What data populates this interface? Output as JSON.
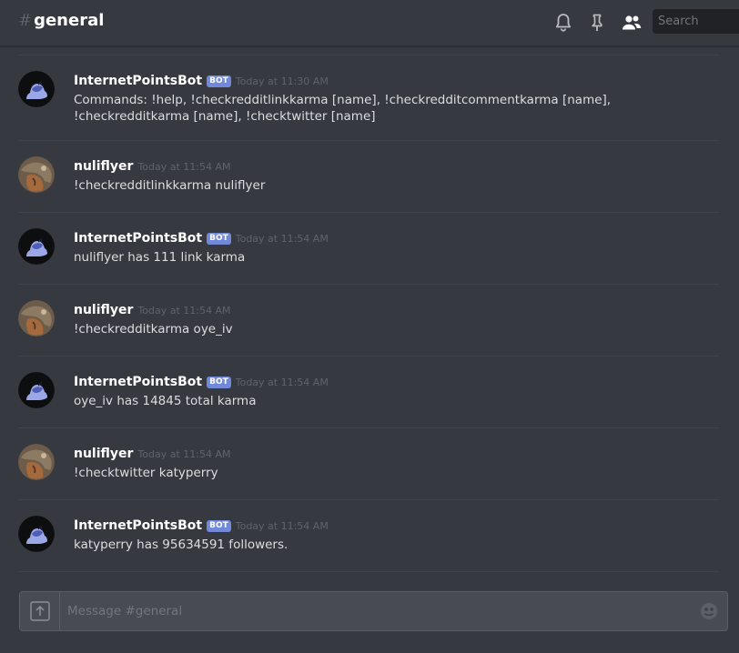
{
  "header": {
    "hash": "#",
    "channel": "general",
    "search_placeholder": "Search",
    "icons": [
      "bell-icon",
      "pin-icon",
      "members-icon"
    ]
  },
  "messages": [
    {
      "author": "InternetPointsBot",
      "bot": true,
      "badge": "BOT",
      "timestamp": "Today at 11:30 AM",
      "text": "Commands: !help, !checkredditlinkkarma [name], !checkredditcommentkarma [name], !checkredditkarma [name], !checktwitter [name]",
      "avatar": "bot-avatar"
    },
    {
      "author": "nuliflyer",
      "bot": false,
      "timestamp": "Today at 11:54 AM",
      "text": "!checkredditlinkkarma nuliflyer",
      "avatar": "user-avatar"
    },
    {
      "author": "InternetPointsBot",
      "bot": true,
      "badge": "BOT",
      "timestamp": "Today at 11:54 AM",
      "text": "nuliflyer has 111 link karma",
      "avatar": "bot-avatar"
    },
    {
      "author": "nuliflyer",
      "bot": false,
      "timestamp": "Today at 11:54 AM",
      "text": "!checkredditkarma oye_iv",
      "avatar": "user-avatar"
    },
    {
      "author": "InternetPointsBot",
      "bot": true,
      "badge": "BOT",
      "timestamp": "Today at 11:54 AM",
      "text": "oye_iv has 14845 total karma",
      "avatar": "bot-avatar"
    },
    {
      "author": "nuliflyer",
      "bot": false,
      "timestamp": "Today at 11:54 AM",
      "text": "!checktwitter katyperry",
      "avatar": "user-avatar"
    },
    {
      "author": "InternetPointsBot",
      "bot": true,
      "badge": "BOT",
      "timestamp": "Today at 11:54 AM",
      "text": "katyperry has 95634591 followers.",
      "avatar": "bot-avatar"
    }
  ],
  "composer": {
    "placeholder": "Message #general",
    "icons": [
      "upload-icon",
      "emoji-icon"
    ]
  },
  "colors": {
    "background": "#36393f",
    "bot_badge": "#7289da",
    "username": "#ffffff",
    "timestamp": "#5f636a",
    "bot_avatar_accent": "#7b8fe8"
  }
}
